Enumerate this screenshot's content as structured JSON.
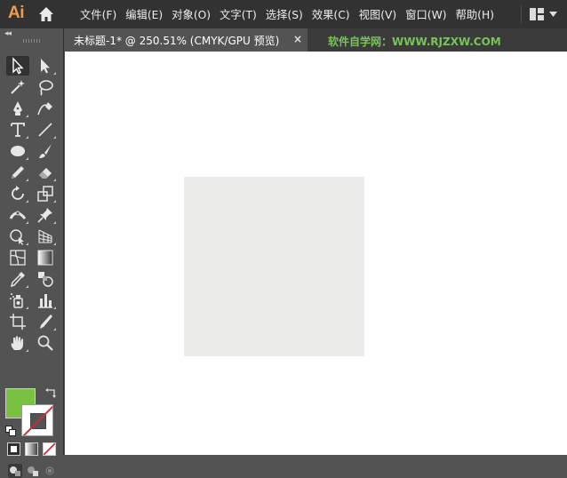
{
  "app": {
    "logo_text": "Ai",
    "accent_color": "#f59b44"
  },
  "menu": {
    "items": [
      "文件(F)",
      "编辑(E)",
      "对象(O)",
      "文字(T)",
      "选择(S)",
      "效果(C)",
      "视图(V)",
      "窗口(W)",
      "帮助(H)"
    ]
  },
  "icons": {
    "home": "home-icon",
    "workspace": "workspace-switcher-icon"
  },
  "toolbar": {
    "collapse_glyph": "◂◂",
    "tools": [
      "selection-tool",
      "direct-selection-tool",
      "magic-wand-tool",
      "lasso-tool",
      "pen-tool",
      "curvature-tool",
      "type-tool",
      "line-segment-tool",
      "ellipse-tool",
      "paintbrush-tool",
      "pencil-tool",
      "eraser-tool",
      "rotate-tool",
      "scale-tool",
      "width-tool",
      "puppet-warp-tool",
      "shape-builder-tool",
      "perspective-grid-tool",
      "mesh-tool",
      "gradient-tool",
      "eyedropper-tool",
      "blend-tool",
      "symbol-sprayer-tool",
      "column-graph-tool",
      "artboard-tool",
      "slice-tool",
      "hand-tool",
      "zoom-tool"
    ],
    "active_tool": "selection-tool",
    "fill_color": "#7ac143",
    "stroke_color": "none"
  },
  "document": {
    "tab_title": "未标题-1* @ 250.51% (CMYK/GPU 预览)",
    "close_glyph": "×",
    "zoom": "250.51%",
    "color_mode": "CMYK/GPU 预览"
  },
  "watermark": {
    "text": "软件自学网：WWW.RJZXW.COM",
    "color": "#79c35a"
  },
  "canvas": {
    "rect_fill": "#ebebe9"
  }
}
